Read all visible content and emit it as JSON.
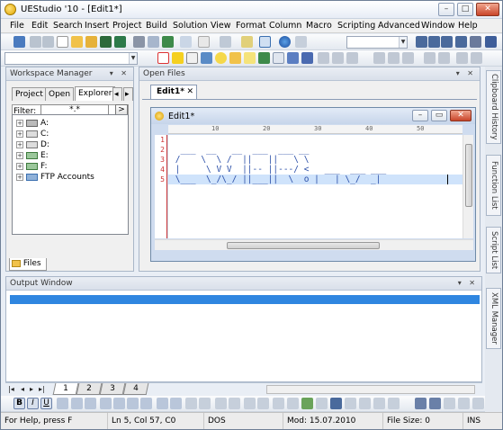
{
  "window": {
    "title": "UEStudio '10 - [Edit1*]"
  },
  "menu": [
    "File",
    "Edit",
    "Search",
    "Insert",
    "Project",
    "Build",
    "Solution",
    "View",
    "Format",
    "Column",
    "Macro",
    "Scripting",
    "Advanced",
    "Window",
    "Help"
  ],
  "workspace": {
    "title": "Workspace Manager",
    "tabs": [
      "Project",
      "Open",
      "Explorer"
    ],
    "filter_label": "Filter:",
    "filter_value": "*.*",
    "filter_button": ">",
    "tree": [
      {
        "label": "A:",
        "icon": "floppy-drive-icon"
      },
      {
        "label": "C:",
        "icon": "hard-drive-icon"
      },
      {
        "label": "D:",
        "icon": "hard-drive-icon"
      },
      {
        "label": "E:",
        "icon": "network-drive-icon"
      },
      {
        "label": "F:",
        "icon": "network-drive-icon"
      },
      {
        "label": "FTP Accounts",
        "icon": "ftp-icon"
      }
    ],
    "bottom_tab": "Files"
  },
  "open_files": {
    "title": "Open Files",
    "tab": "Edit1*"
  },
  "editor": {
    "title": "Edit1*",
    "ruler_marks": [
      "10",
      "20",
      "30",
      "40",
      "50",
      "60",
      "70"
    ],
    "line_numbers": [
      "1",
      "2",
      "3",
      "4",
      "5"
    ],
    "lines": [
      "",
      "  ___  __   __  ___  ___ __",
      " /    \\  \\ /  ||   ||   \\ \\",
      " |     \\ V V  ||-- ||---/ <   ___  ___ ___",
      " \\___  \\_/\\_/ ||___||  \\  o |   | \\_/  _|"
    ]
  },
  "output": {
    "title": "Output Window"
  },
  "sheet_tabs": [
    "1",
    "2",
    "3",
    "4"
  ],
  "side_tabs": [
    "Clipboard History",
    "Function List",
    "Script List",
    "XML Manager"
  ],
  "status": {
    "help": "For Help, press F",
    "position": "Ln 5, Col 57, C0",
    "format": "DOS",
    "modified": "Mod: 15.07.2010 13:01:03",
    "size": "File Size: 0",
    "mode": "INS"
  },
  "colors": {
    "accent": "#2f86e0",
    "line_number": "#cc3333",
    "text": "#2b4fa8",
    "current_line": "#cfe3fb"
  }
}
